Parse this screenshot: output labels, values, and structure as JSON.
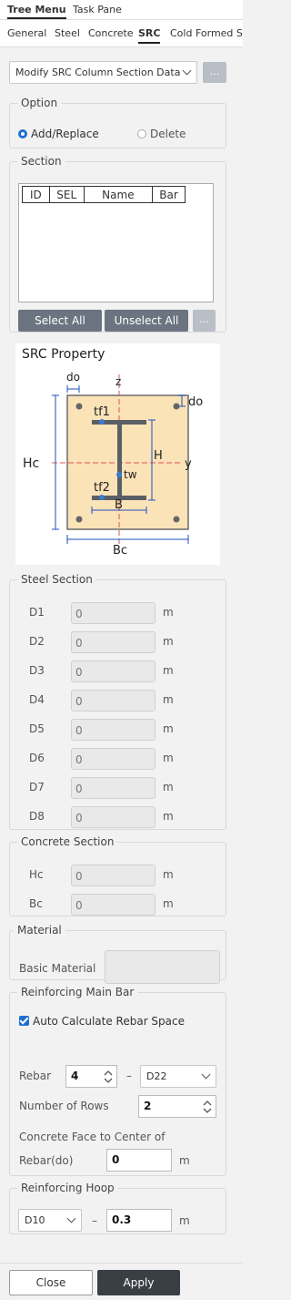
{
  "top_tabs": [
    "Tree Menu",
    "Task Pane"
  ],
  "sub_tabs": [
    "General",
    "Steel",
    "Concrete",
    "SRC",
    "Cold Formed Ste"
  ],
  "command": {
    "value": "Modify SRC Column Section Data",
    "more": "..."
  },
  "option": {
    "legend": "Option",
    "add": "Add/Replace",
    "delete": "Delete"
  },
  "section": {
    "legend": "Section",
    "headers": [
      "ID",
      "SEL",
      "Name",
      "Bar"
    ],
    "select_all": "Select All",
    "unselect_all": "Unselect All",
    "more": "..."
  },
  "src_property": {
    "title": "SRC Property",
    "labels": {
      "do_top": "do",
      "z": "z",
      "do_right": "do",
      "tf1": "tf1",
      "Hc": "Hc",
      "H": "H",
      "y": "y",
      "tw": "tw",
      "tf2": "tf2",
      "B": "B",
      "Bc": "Bc"
    }
  },
  "steel_section": {
    "legend": "Steel Section",
    "rows": [
      {
        "label": "D1",
        "value": "0",
        "unit": "m"
      },
      {
        "label": "D2",
        "value": "0",
        "unit": "m"
      },
      {
        "label": "D3",
        "value": "0",
        "unit": "m"
      },
      {
        "label": "D4",
        "value": "0",
        "unit": "m"
      },
      {
        "label": "D5",
        "value": "0",
        "unit": "m"
      },
      {
        "label": "D6",
        "value": "0",
        "unit": "m"
      },
      {
        "label": "D7",
        "value": "0",
        "unit": "m"
      },
      {
        "label": "D8",
        "value": "0",
        "unit": "m"
      }
    ]
  },
  "concrete_section": {
    "legend": "Concrete Section",
    "rows": [
      {
        "label": "Hc",
        "value": "0",
        "unit": "m"
      },
      {
        "label": "Bc",
        "value": "0",
        "unit": "m"
      }
    ]
  },
  "material": {
    "legend": "Material",
    "label": "Basic Material",
    "value": ""
  },
  "main_bar": {
    "legend": "Reinforcing Main Bar",
    "auto_calc": "Auto Calculate Rebar Space",
    "rebar_label": "Rebar",
    "rebar_count": "4",
    "dash": "–",
    "rebar_size": "D22",
    "rows_label": "Number of Rows",
    "rows_value": "2",
    "face_label1": "Concrete Face to Center of",
    "face_label2": "Rebar(do)",
    "face_value": "0",
    "face_unit": "m"
  },
  "hoop": {
    "legend": "Reinforcing Hoop",
    "size": "D10",
    "dash": "–",
    "value": "0.3",
    "unit": "m"
  },
  "footer": {
    "close": "Close",
    "apply": "Apply"
  },
  "colors": {
    "accent": "#1f6fd1",
    "footer_apply": "#3a3f46",
    "button_dark": "#6b7480",
    "diagram_fill": "#fbe3b8",
    "diagram_steel": "#5a5f66"
  }
}
